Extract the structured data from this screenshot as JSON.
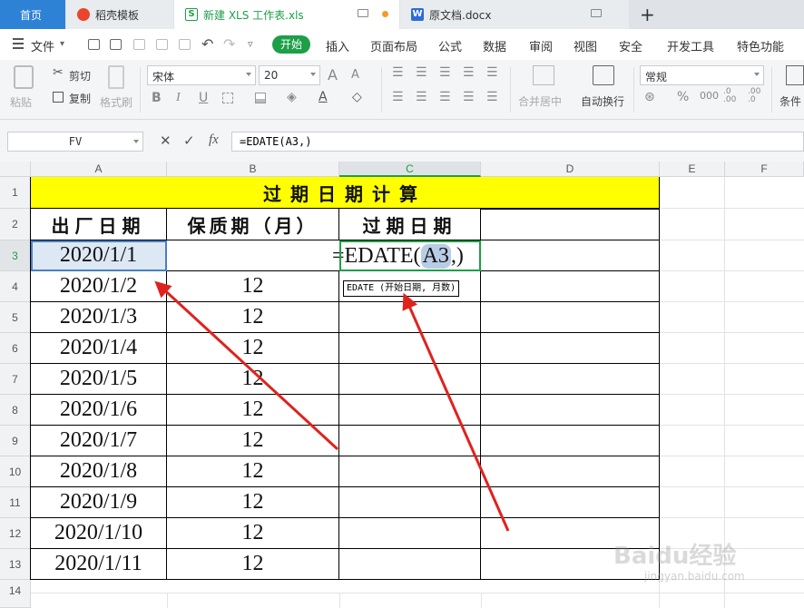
{
  "tabs": [
    {
      "label": "首页"
    },
    {
      "label": "稻壳模板"
    },
    {
      "label": "新建 XLS 工作表.xls"
    },
    {
      "label": "原文档.docx"
    }
  ],
  "menubar": {
    "file_label": "文件",
    "items": [
      "开始",
      "插入",
      "页面布局",
      "公式",
      "数据",
      "审阅",
      "视图",
      "安全",
      "开发工具",
      "特色功能"
    ]
  },
  "ribbon": {
    "paste": "粘贴",
    "cut": "剪切",
    "copy": "复制",
    "format_painter": "格式刷",
    "font_name": "宋体",
    "font_size": "20",
    "bold": "B",
    "italic": "I",
    "underline": "U",
    "merge_center": "合并居中",
    "wrap_text": "自动换行",
    "number_format": "常规",
    "conditional": "条件"
  },
  "formula_bar": {
    "name_box": "FV",
    "formula": "=EDATE(A3,)"
  },
  "columns": [
    "A",
    "B",
    "C",
    "D",
    "E",
    "F"
  ],
  "rows": [
    "1",
    "2",
    "3",
    "4",
    "5",
    "6",
    "7",
    "8",
    "9",
    "10",
    "11",
    "12",
    "13",
    "14"
  ],
  "sheet": {
    "title": "过期日期计算",
    "headers": [
      "出厂日期",
      "保质期（月）",
      "过期日期"
    ],
    "editing_formula": "=EDATE(A3,)",
    "formula_prefix": "=EDATE(",
    "formula_ref": "A3",
    "formula_suffix": ",)",
    "tooltip": "EDATE (开始日期, 月数)",
    "data": [
      {
        "date": "2020/1/1",
        "months": ""
      },
      {
        "date": "2020/1/2",
        "months": "12"
      },
      {
        "date": "2020/1/3",
        "months": "12"
      },
      {
        "date": "2020/1/4",
        "months": "12"
      },
      {
        "date": "2020/1/5",
        "months": "12"
      },
      {
        "date": "2020/1/6",
        "months": "12"
      },
      {
        "date": "2020/1/7",
        "months": "12"
      },
      {
        "date": "2020/1/8",
        "months": "12"
      },
      {
        "date": "2020/1/9",
        "months": "12"
      },
      {
        "date": "2020/1/10",
        "months": "12"
      },
      {
        "date": "2020/1/11",
        "months": "12"
      }
    ]
  },
  "watermark": {
    "brand": "Baidu经验",
    "url": "jingyan.baidu.com"
  },
  "colors": {
    "accent_green": "#1d9f47",
    "title_fill": "#ffff00",
    "arrow": "#e0221e",
    "home_tab": "#2e82d6"
  }
}
